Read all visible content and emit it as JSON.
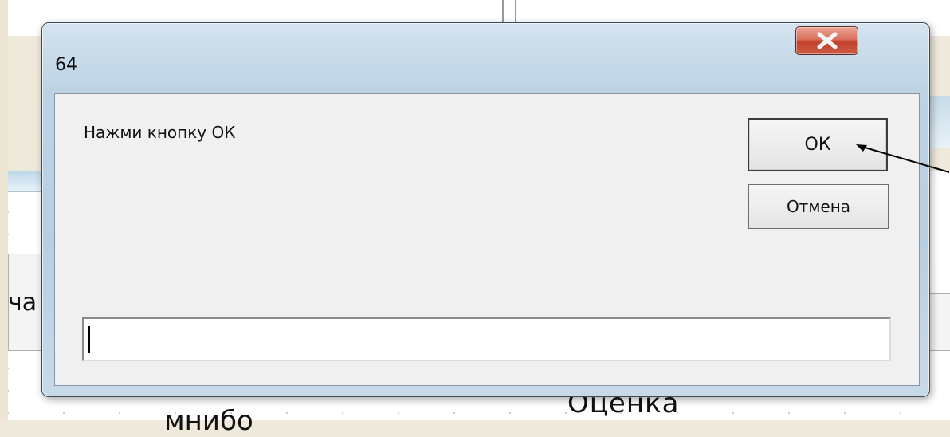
{
  "background": {
    "left_text": "ча",
    "bottom_text": "Оценка",
    "bottom_text2": "мнибо"
  },
  "dialog": {
    "title": "64",
    "prompt": "Нажми кнопку ОК",
    "ok_label": "ОК",
    "cancel_label": "Отмена",
    "input_value": "",
    "close_icon": "close-icon"
  },
  "colors": {
    "close_button": "#c94a34",
    "client_area": "#f0f0f0",
    "frame": "#bdd3e4"
  }
}
